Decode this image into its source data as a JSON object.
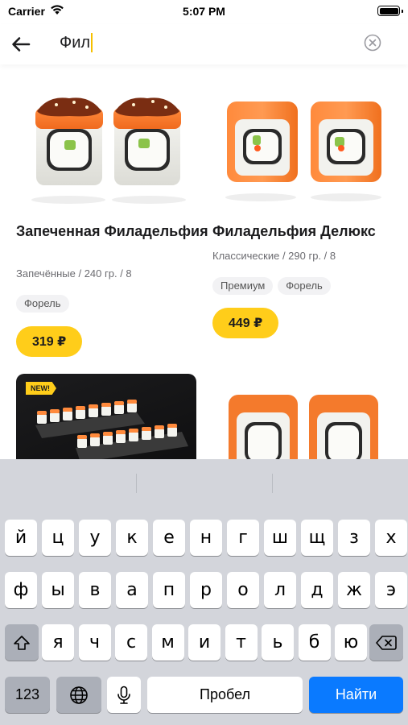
{
  "status_bar": {
    "carrier": "Carrier",
    "time": "5:07 PM",
    "battery_level": 1.0
  },
  "search": {
    "query": "Фил",
    "back_icon": "arrow-left-icon",
    "clear_icon": "clear-circle-icon"
  },
  "products": [
    {
      "title": "Запеченная Филадельфия",
      "meta": "Запечённые / 240 гр. / 8",
      "tags": [
        "Форель"
      ],
      "price": "319 ₽"
    },
    {
      "title": "Филадельфия Делюкс",
      "meta": "Классические / 290 гр. / 8",
      "tags": [
        "Премиум",
        "Форель"
      ],
      "price": "449 ₽"
    }
  ],
  "promo": {
    "badge": "NEW!"
  },
  "keyboard": {
    "row1": [
      "й",
      "ц",
      "у",
      "к",
      "е",
      "н",
      "г",
      "ш",
      "щ",
      "з",
      "х"
    ],
    "row2": [
      "ф",
      "ы",
      "в",
      "а",
      "п",
      "р",
      "о",
      "л",
      "д",
      "ж",
      "э"
    ],
    "row3": [
      "я",
      "ч",
      "с",
      "м",
      "и",
      "т",
      "ь",
      "б",
      "ю"
    ],
    "numbers_label": "123",
    "space_label": "Пробел",
    "go_label": "Найти",
    "shift_icon": "shift-icon",
    "backspace_icon": "backspace-icon",
    "globe_icon": "globe-icon",
    "mic_icon": "microphone-icon"
  },
  "colors": {
    "accent": "#ffcd1a",
    "go_key": "#0a7aff",
    "keyboard_bg": "#d3d5db"
  }
}
